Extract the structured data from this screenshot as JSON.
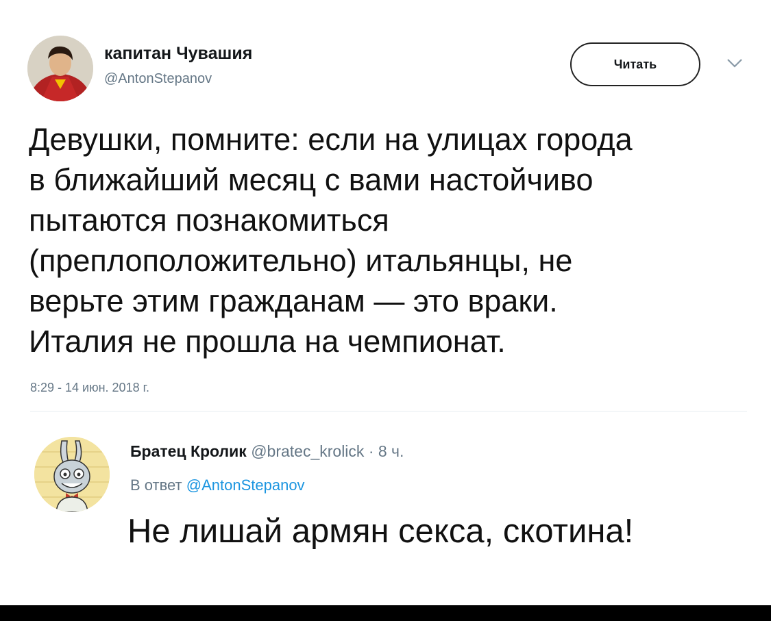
{
  "tweet": {
    "author_name": "капитан Чувашия",
    "author_handle": "@AntonStepanov",
    "follow_label": "Читать",
    "text_lines": [
      "Девушки, помните: если на улицах города",
      "в ближайший месяц с вами настойчиво",
      "пытаются познакомиться",
      "(преплоположительно) итальянцы, не",
      "верьте этим гражданам — это враки.",
      "Италия не прошла на чемпионат."
    ],
    "timestamp": "8:29 - 14 июн. 2018 г."
  },
  "reply": {
    "author_name": "Братец Кролик",
    "author_handle": "@bratec_krolick",
    "separator": "·",
    "time": "8 ч.",
    "reply_to_prefix": "В ответ",
    "reply_to_handle": "@AntonStepanov",
    "text": "Не лишай армян секса, скотина!"
  },
  "icons": {
    "menu": "chevron-down-icon"
  },
  "colors": {
    "handle_gray": "#657786",
    "mention_blue": "#1b95e0",
    "divider": "#e6ecf0"
  }
}
